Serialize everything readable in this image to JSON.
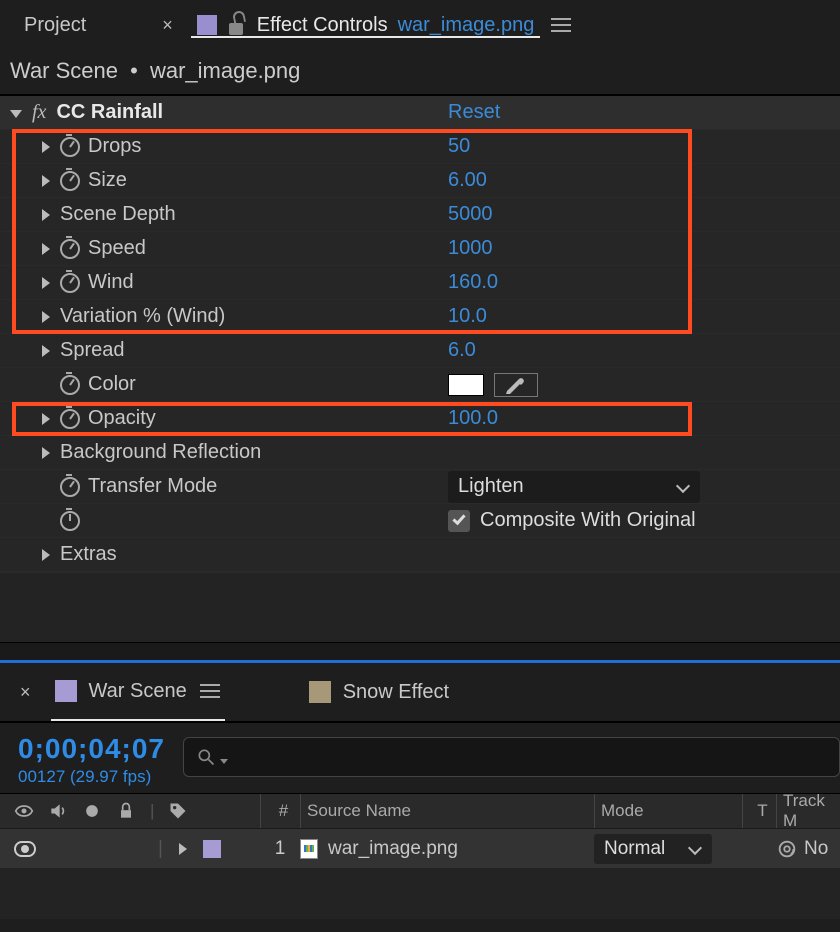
{
  "tabs": {
    "project": "Project",
    "effect_controls": "Effect Controls",
    "ec_filename": "war_image.png"
  },
  "breadcrumb": {
    "comp": "War Scene",
    "layer": "war_image.png"
  },
  "effect": {
    "name": "CC Rainfall",
    "reset": "Reset",
    "props": {
      "drops_label": "Drops",
      "drops_val": "50",
      "size_label": "Size",
      "size_val": "6.00",
      "scene_depth_label": "Scene Depth",
      "scene_depth_val": "5000",
      "speed_label": "Speed",
      "speed_val": "1000",
      "wind_label": "Wind",
      "wind_val": "160.0",
      "variation_label": "Variation % (Wind)",
      "variation_val": "10.0",
      "spread_label": "Spread",
      "spread_val": "6.0",
      "color_label": "Color",
      "opacity_label": "Opacity",
      "opacity_val": "100.0",
      "bg_reflect_label": "Background Reflection",
      "transfer_mode_label": "Transfer Mode",
      "transfer_mode_val": "Lighten",
      "composite_label": "Composite With Original",
      "extras_label": "Extras"
    }
  },
  "timeline": {
    "comps": {
      "active": "War Scene",
      "other": "Snow Effect"
    },
    "timecode": "0;00;04;07",
    "frame_info": "00127 (29.97 fps)",
    "headers": {
      "hash": "#",
      "source": "Source Name",
      "mode": "Mode",
      "t": "T",
      "track": "Track M"
    },
    "layer1": {
      "num": "1",
      "name": "war_image.png",
      "mode": "Normal",
      "track": "No"
    }
  }
}
